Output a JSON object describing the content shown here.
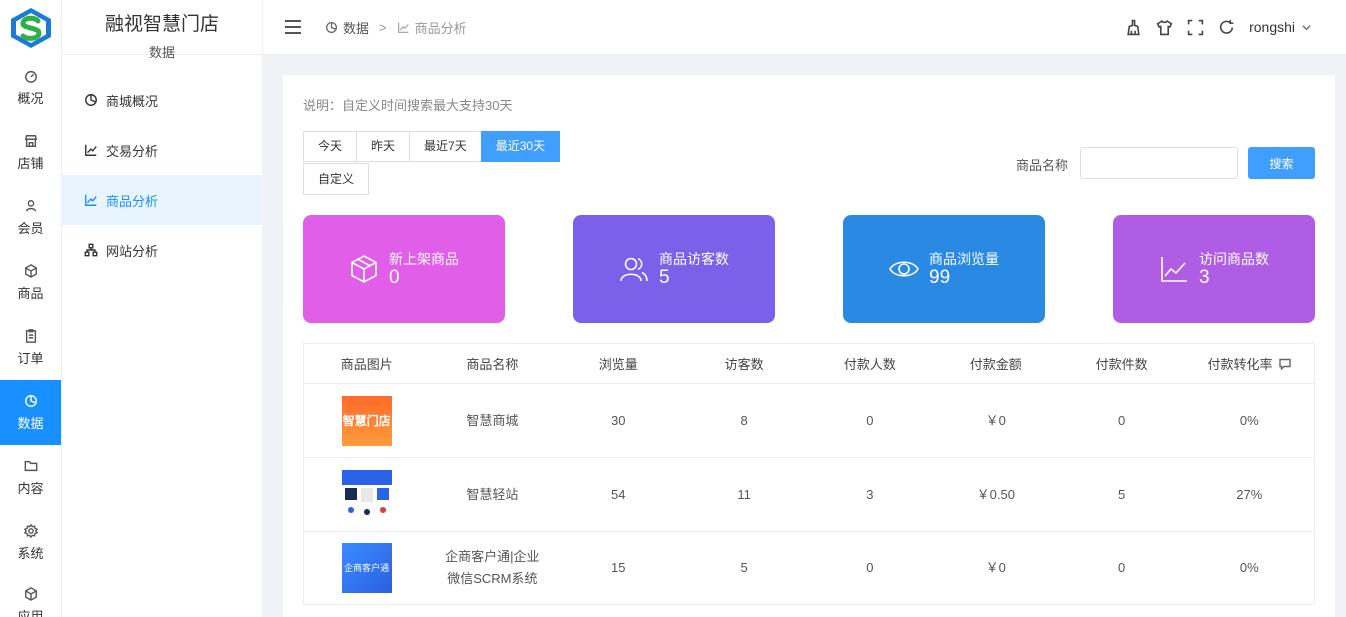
{
  "rail": {
    "items": [
      {
        "label": "概况",
        "icon": "gauge-icon"
      },
      {
        "label": "店铺",
        "icon": "store-icon"
      },
      {
        "label": "会员",
        "icon": "user-icon"
      },
      {
        "label": "商品",
        "icon": "cube-icon"
      },
      {
        "label": "订单",
        "icon": "clipboard-icon"
      },
      {
        "label": "数据",
        "icon": "pie-chart-icon",
        "active": true
      },
      {
        "label": "内容",
        "icon": "folder-icon"
      },
      {
        "label": "系统",
        "icon": "gear-icon"
      },
      {
        "label": "应用",
        "icon": "app-cube-icon"
      }
    ]
  },
  "brand": {
    "name": "融视智慧门店",
    "section": "数据"
  },
  "subnav": {
    "items": [
      {
        "label": "商城概况",
        "icon": "pie-chart-icon"
      },
      {
        "label": "交易分析",
        "icon": "trend-icon"
      },
      {
        "label": "商品分析",
        "icon": "trend-icon",
        "active": true
      },
      {
        "label": "网站分析",
        "icon": "sitemap-icon"
      }
    ]
  },
  "header": {
    "breadcrumb": {
      "root": "数据",
      "separator": ">",
      "current": "商品分析"
    },
    "username": "rongshi"
  },
  "main": {
    "note": "说明：自定义时间搜索最大支持30天",
    "ranges": [
      "今天",
      "昨天",
      "最近7天",
      "最近30天"
    ],
    "active_range": "最近30天",
    "custom_label": "自定义",
    "search": {
      "label": "商品名称",
      "value": "",
      "button": "搜索"
    },
    "stats": [
      {
        "label": "新上架商品",
        "value": "0",
        "color": "#e15ee8",
        "icon": "box-icon"
      },
      {
        "label": "商品访客数",
        "value": "5",
        "color": "#7b60ea",
        "icon": "users-icon"
      },
      {
        "label": "商品浏览量",
        "value": "99",
        "color": "#2a8ae3",
        "icon": "eye-icon"
      },
      {
        "label": "访问商品数",
        "value": "3",
        "color": "#b05de6",
        "icon": "line-chart-icon"
      }
    ],
    "table": {
      "columns": [
        "商品图片",
        "商品名称",
        "浏览量",
        "访客数",
        "付款人数",
        "付款金额",
        "付款件数",
        "付款转化率"
      ],
      "rows": [
        {
          "thumb": "智慧门店",
          "name": "智慧商城",
          "views": "30",
          "visitors": "8",
          "buyers": "0",
          "amount": "￥0",
          "count": "0",
          "rate": "0%"
        },
        {
          "thumb": "",
          "name": "智慧轻站",
          "views": "54",
          "visitors": "11",
          "buyers": "3",
          "amount": "￥0.50",
          "count": "5",
          "rate": "27%"
        },
        {
          "thumb": "企商客户通",
          "name": "企商客户通|企业微信SCRM系统",
          "views": "15",
          "visitors": "5",
          "buyers": "0",
          "amount": "￥0",
          "count": "0",
          "rate": "0%"
        }
      ]
    }
  }
}
